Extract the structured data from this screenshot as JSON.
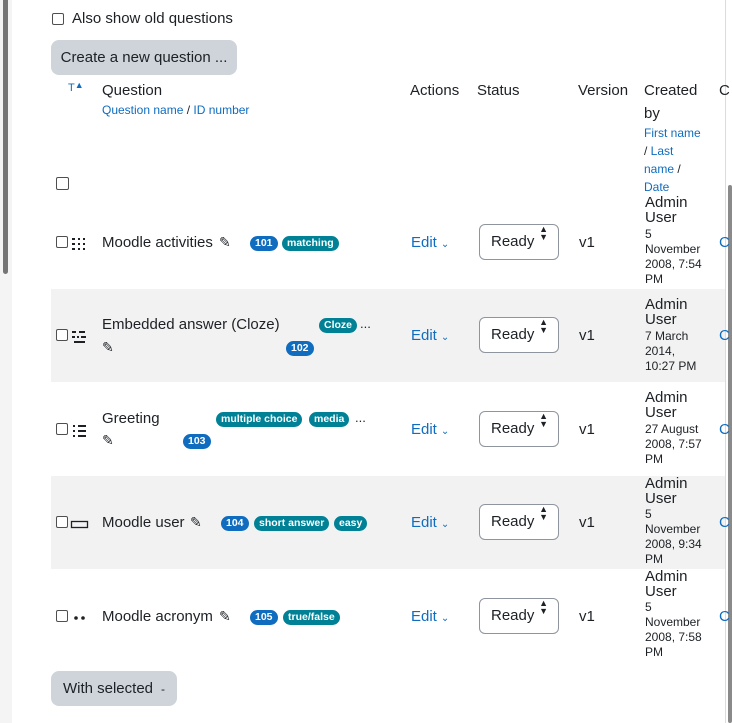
{
  "options": {
    "show_old_label": "Also show old questions"
  },
  "create_button": "Create a new question ...",
  "header": {
    "type_col": "T",
    "question": "Question",
    "question_sub_name": "Question name",
    "question_sub_sep": " / ",
    "question_sub_id": "ID number",
    "actions": "Actions",
    "status": "Status",
    "version": "Version",
    "created_by_1": "Created",
    "created_by_2": "by",
    "sort_first": "First name",
    "sort_sep1": "/ ",
    "sort_last_1": "Last",
    "sort_last_2": "name",
    "sort_sep2": " /",
    "sort_date": "Date",
    "next_col_clip": "C"
  },
  "rows": [
    {
      "name": "Moodle activities",
      "id_badge": "101",
      "tags": [
        "matching"
      ],
      "more": "",
      "edit": "Edit",
      "status": "Ready",
      "version": "v1",
      "creator_1": "Admin",
      "creator_2": "User",
      "date_lines": [
        "5",
        "November",
        "2008, 7:54",
        "PM"
      ],
      "clip": "C"
    },
    {
      "name": "Embedded answer (Cloze)",
      "id_badge": "102",
      "tags": [
        "Cloze"
      ],
      "more": "...",
      "edit": "Edit",
      "status": "Ready",
      "version": "v1",
      "creator_1": "Admin",
      "creator_2": "User",
      "date_lines": [
        "7 March",
        "2014,",
        "10:27 PM"
      ],
      "clip": "C"
    },
    {
      "name": "Greeting",
      "id_badge": "103",
      "tags": [
        "multiple choice",
        "media"
      ],
      "more": "...",
      "edit": "Edit",
      "status": "Ready",
      "version": "v1",
      "creator_1": "Admin",
      "creator_2": "User",
      "date_lines": [
        "27 August",
        "2008, 7:57",
        "PM"
      ],
      "clip": "C"
    },
    {
      "name": "Moodle user",
      "id_badge": "104",
      "tags": [
        "short answer",
        "easy"
      ],
      "more": "",
      "edit": "Edit",
      "status": "Ready",
      "version": "v1",
      "creator_1": "Admin",
      "creator_2": "User",
      "date_lines": [
        "5",
        "November",
        "2008, 9:34",
        "PM"
      ],
      "clip": "C"
    },
    {
      "name": "Moodle acronym",
      "id_badge": "105",
      "tags": [
        "true/false"
      ],
      "more": "",
      "edit": "Edit",
      "status": "Ready",
      "version": "v1",
      "creator_1": "Admin",
      "creator_2": "User",
      "date_lines": [
        "5",
        "November",
        "2008, 7:58",
        "PM"
      ],
      "clip": "C"
    }
  ],
  "bulk_button": "With selected",
  "bulk_caret": "-",
  "colors": {
    "link": "#0f6cbf",
    "id_badge": "#0f6cbf",
    "tag_badge": "#008196",
    "stripe": "#f2f2f2",
    "button": "#ced4da"
  }
}
